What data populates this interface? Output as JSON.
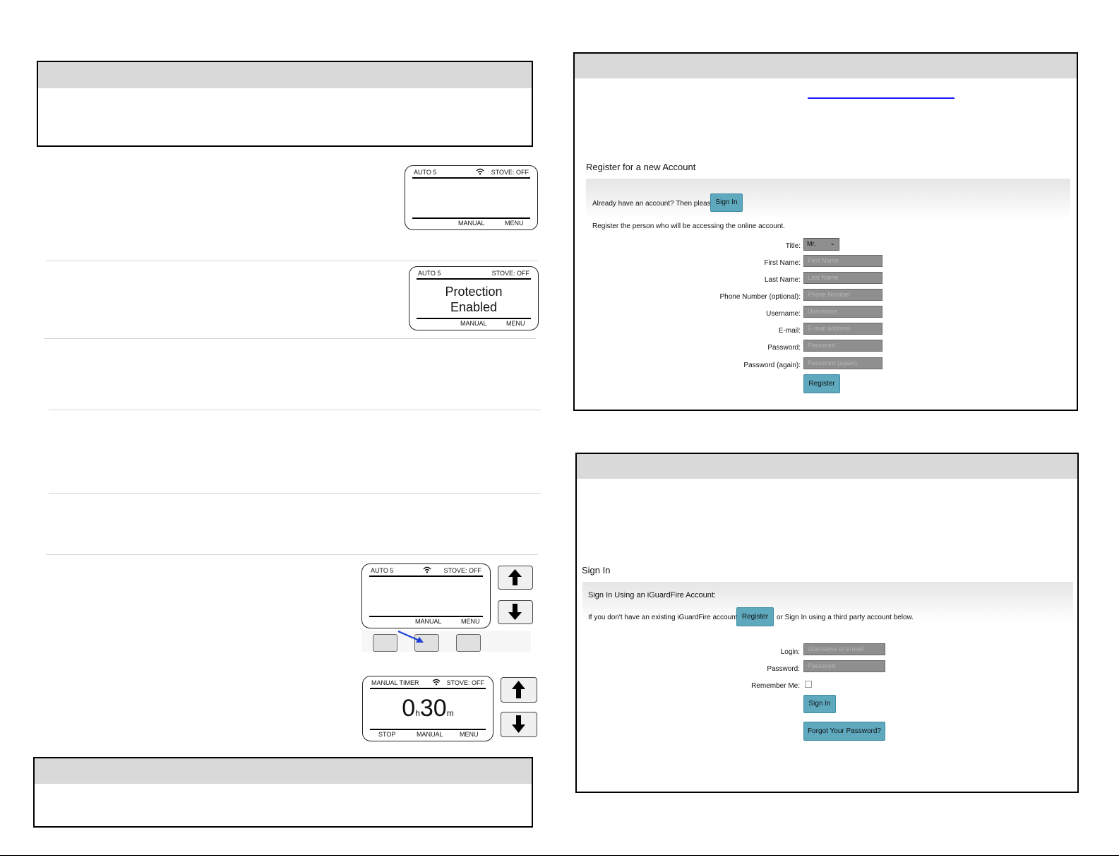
{
  "device_screens": {
    "screen1": {
      "mode": "AUTO 5",
      "stove": "STOVE: OFF",
      "soft_manual": "MANUAL",
      "soft_menu": "MENU"
    },
    "screen2": {
      "mode": "AUTO 5",
      "stove": "STOVE: OFF",
      "message_line1": "Protection",
      "message_line2": "Enabled",
      "soft_manual": "MANUAL",
      "soft_menu": "MENU"
    },
    "screen3": {
      "mode": "AUTO 5",
      "stove": "STOVE: OFF",
      "soft_manual": "MANUAL",
      "soft_menu": "MENU"
    },
    "screen4": {
      "mode": "MANUAL TIMER",
      "stove": "STOVE: OFF",
      "hours": "0",
      "hours_unit": "h",
      "minutes": "30",
      "minutes_unit": "m",
      "soft_stop": "STOP",
      "soft_manual": "MANUAL",
      "soft_menu": "MENU"
    }
  },
  "icons": {
    "wifi": "wifi-icon",
    "up": "up-arrow-icon",
    "down": "down-arrow-icon",
    "pointer": "pointer-arrow-icon"
  },
  "colors": {
    "header_gray": "#d9d9d9",
    "button_teal": "#5fa9bf",
    "input_gray": "#8f8f8f",
    "link_blue": "#1a1aff",
    "pointer_blue": "#1f3fd6"
  },
  "register_form": {
    "heading": "Register for a new Account",
    "already_text": "Already have an account? Then please",
    "sign_in_button": "Sign In",
    "instruction": "Register the person who will be accessing the online account.",
    "title_label": "Title:",
    "title_value": "Mr.",
    "fields": [
      {
        "label": "First Name:",
        "placeholder": "First Name"
      },
      {
        "label": "Last Name:",
        "placeholder": "Last Name"
      },
      {
        "label": "Phone Number (optional):",
        "placeholder": "Phone Number"
      },
      {
        "label": "Username:",
        "placeholder": "Username"
      },
      {
        "label": "E-mail:",
        "placeholder": "E-mail address"
      },
      {
        "label": "Password:",
        "placeholder": "Password"
      },
      {
        "label": "Password (again):",
        "placeholder": "Password (again)"
      }
    ],
    "register_button": "Register"
  },
  "signin_form": {
    "heading": "Sign In",
    "sub_heading": "Sign In Using an iGuardFire Account:",
    "no_account_text": "If you don't have an existing iGuardFire account,",
    "register_button": "Register",
    "third_party_text": "or Sign In using a third party account below.",
    "login_label": "Login:",
    "login_placeholder": "Username or e-mail",
    "password_label": "Password:",
    "password_placeholder": "Password",
    "remember_label": "Remember Me:",
    "sign_in_button": "Sign In",
    "forgot_button": "Forgot Your Password?"
  }
}
